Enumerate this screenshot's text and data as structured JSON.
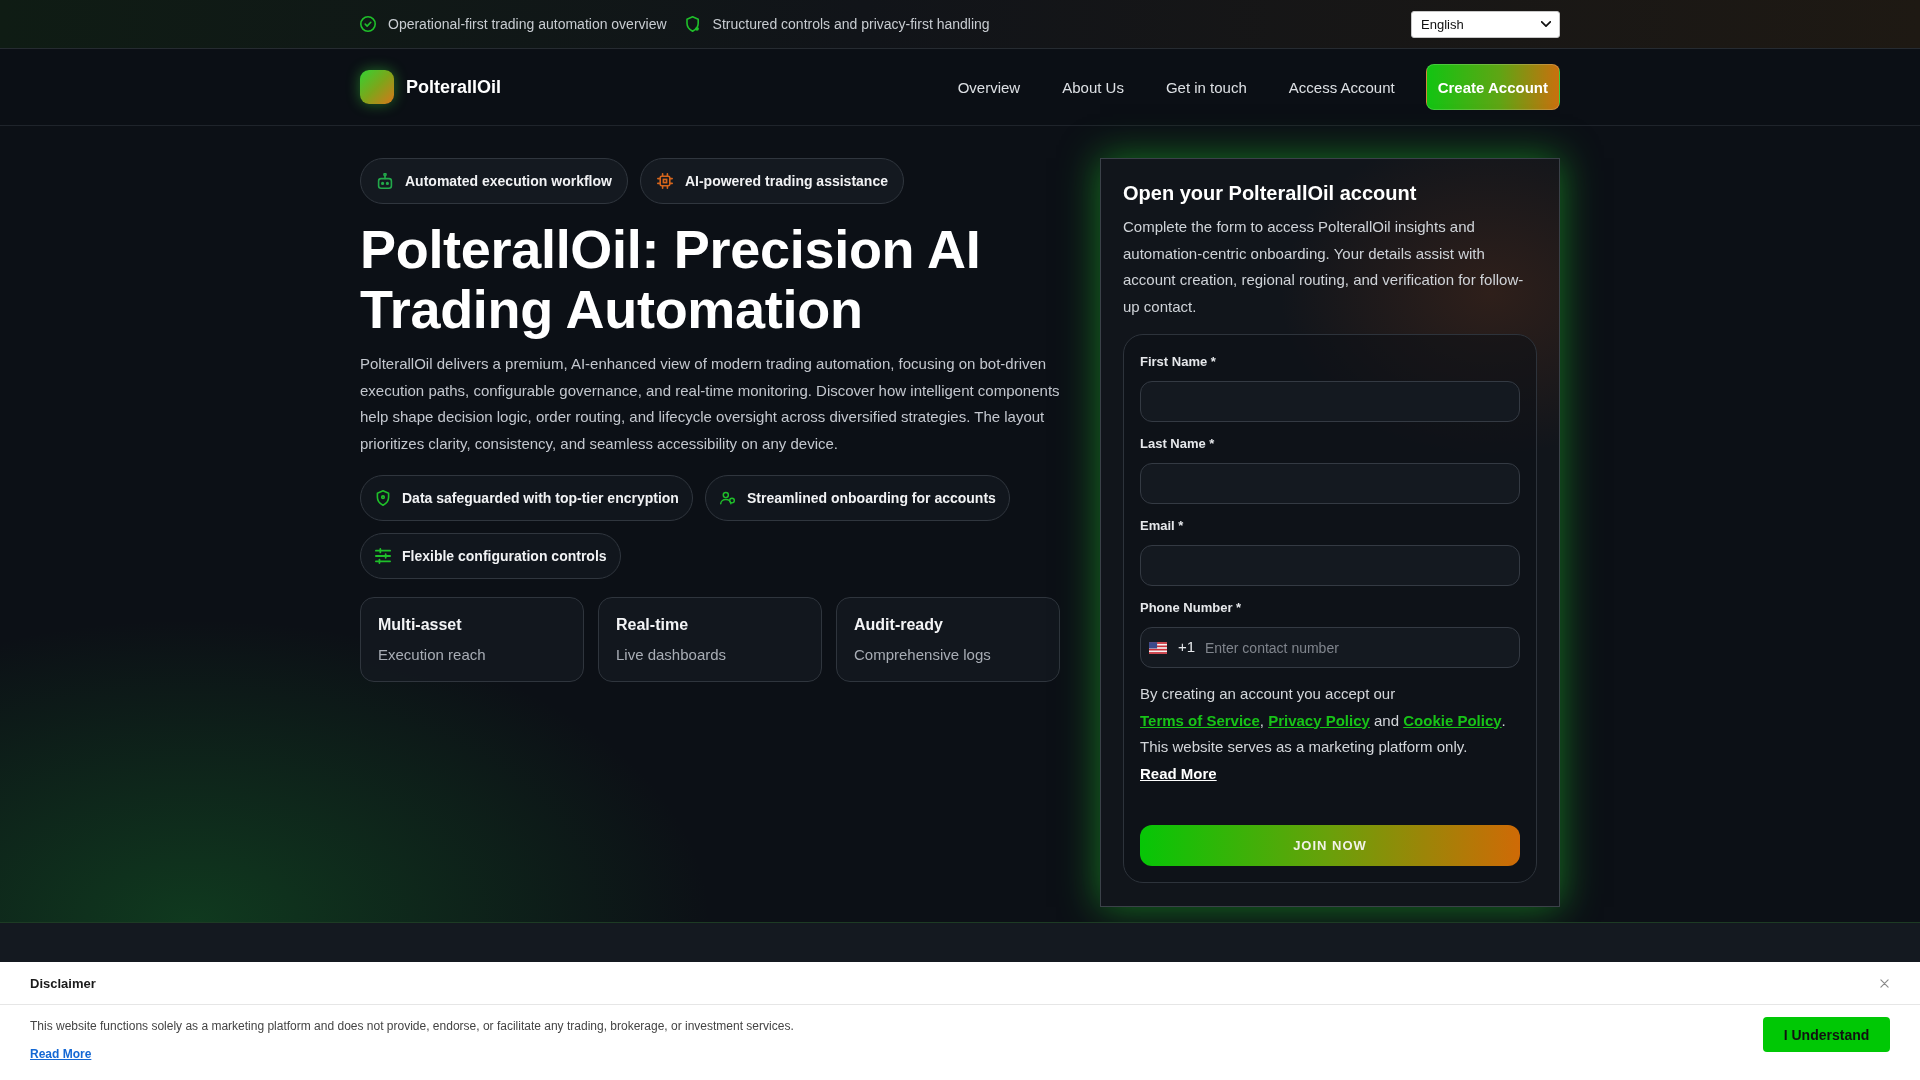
{
  "top_bar": {
    "highlights": [
      "Operational-first trading automation overview",
      "Structured controls and privacy-first handling"
    ],
    "language": "English"
  },
  "nav": {
    "brand": "PolterallOil",
    "links": [
      "Overview",
      "About Us",
      "Get in touch",
      "Access Account"
    ],
    "cta": "Create Account"
  },
  "hero": {
    "badges": [
      {
        "text": "Automated execution workflow",
        "color": "#22a84a"
      },
      {
        "text": "AI-powered trading assistance",
        "color": "#d4651c"
      }
    ],
    "title": "PolterallOil: Precision AI Trading Automation",
    "intro": "PolterallOil delivers a premium, AI-enhanced view of modern trading automation, focusing on bot-driven execution paths, configurable governance, and real-time monitoring. Discover how intelligent components help shape decision logic, order routing, and lifecycle oversight across diversified strategies. The layout prioritizes clarity, consistency, and seamless accessibility on any device.",
    "features": [
      "Data safeguarded with top-tier encryption",
      "Streamlined onboarding for accounts",
      "Flexible configuration controls"
    ],
    "stats": [
      {
        "title": "Multi-asset",
        "subtitle": "Execution reach"
      },
      {
        "title": "Real-time",
        "subtitle": "Live dashboards"
      },
      {
        "title": "Audit-ready",
        "subtitle": "Comprehensive logs"
      }
    ]
  },
  "signup": {
    "title": "Open your PolterallOil account",
    "description": "Complete the form to access PolterallOil insights and automation-centric onboarding. Your details assist with account creation, regional routing, and verification for follow-up contact.",
    "fields": [
      {
        "label": "First Name *"
      },
      {
        "label": "Last Name *"
      },
      {
        "label": "Email *"
      }
    ],
    "phone": {
      "label": "Phone Number *",
      "dial_code": "+1",
      "placeholder": "Enter contact number"
    },
    "consent": [
      {
        "kind": "text",
        "text": "By creating an account you accept our "
      },
      {
        "kind": "link",
        "text": "Terms of Service"
      },
      {
        "kind": "text",
        "text": ", "
      },
      {
        "kind": "link",
        "text": "Privacy Policy"
      },
      {
        "kind": "text",
        "text": " and "
      },
      {
        "kind": "link",
        "text": "Cookie Policy"
      },
      {
        "kind": "text",
        "text": ". This website serves as a marketing platform only. "
      },
      {
        "kind": "more",
        "text": "Read More"
      }
    ],
    "submit": "JOIN NOW"
  },
  "disclaimer": {
    "title": "Disclaimer",
    "text": "This website functions solely as a marketing platform and does not provide, endorse, or facilitate any trading, brokerage, or investment services.",
    "read_more": "Read More",
    "accept": "I Understand"
  }
}
